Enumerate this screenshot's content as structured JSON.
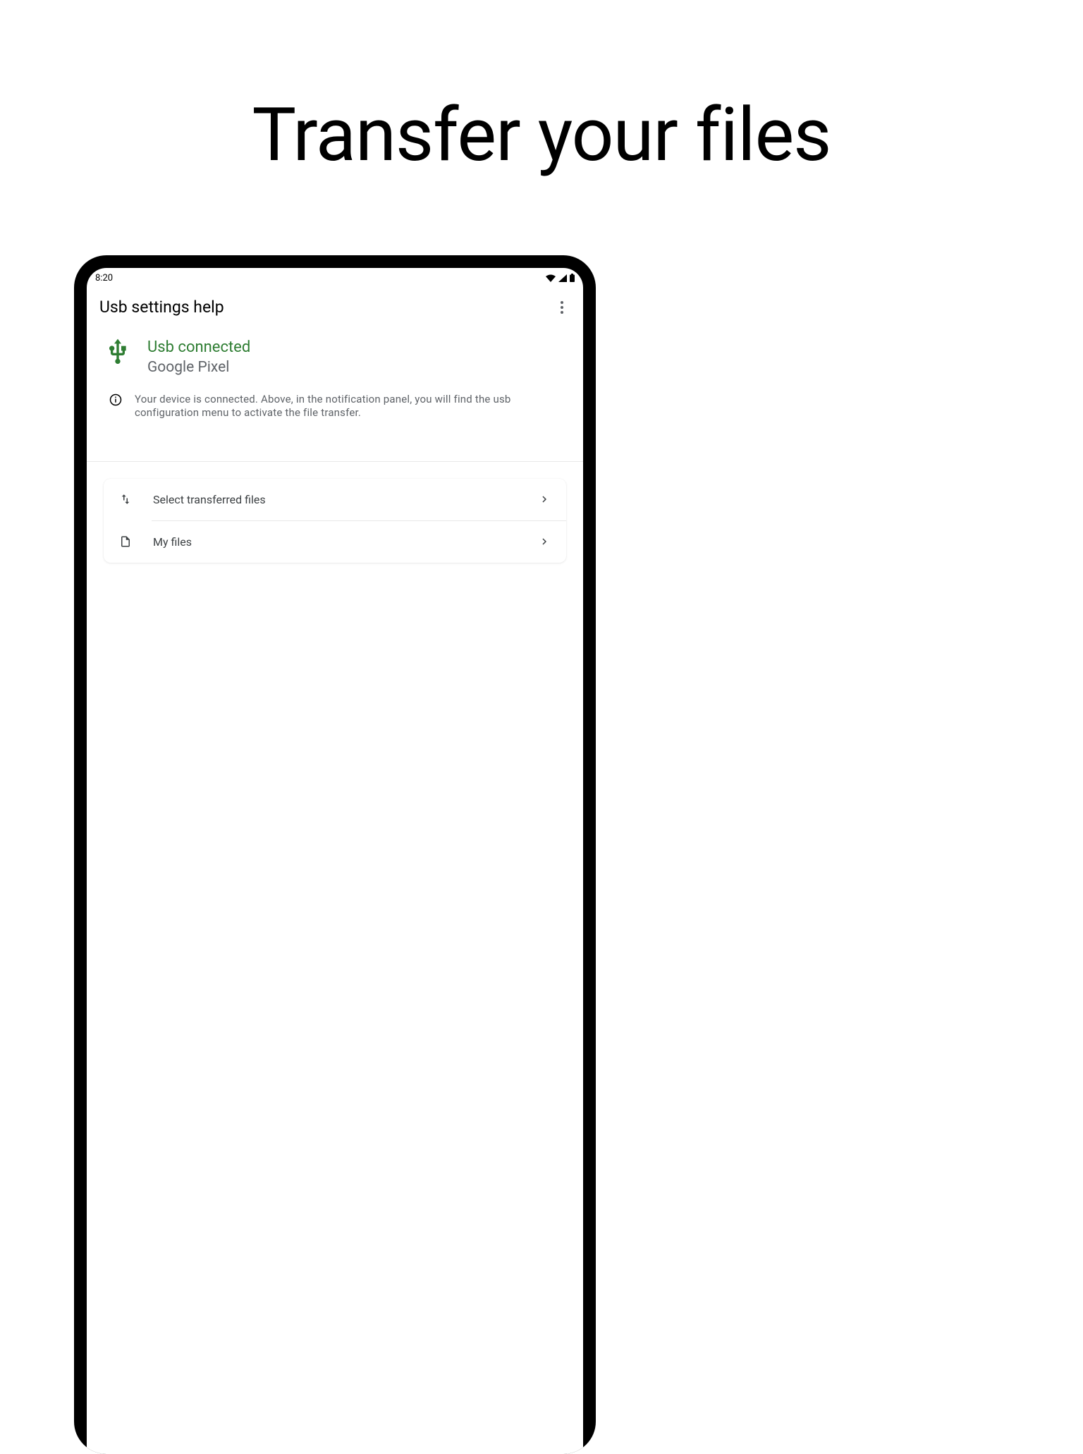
{
  "page_heading": "Transfer your files",
  "status_bar": {
    "time": "8:20"
  },
  "header": {
    "title": "Usb settings help"
  },
  "usb": {
    "title": "Usb connected",
    "device": "Google Pixel"
  },
  "info": {
    "text": "Your device is connected. Above, in the notification panel, you will find the usb configuration menu to activate the file transfer."
  },
  "card": {
    "rows": [
      {
        "label": "Select transferred files"
      },
      {
        "label": "My files"
      }
    ]
  },
  "colors": {
    "accent_green": "#2E7D32"
  }
}
